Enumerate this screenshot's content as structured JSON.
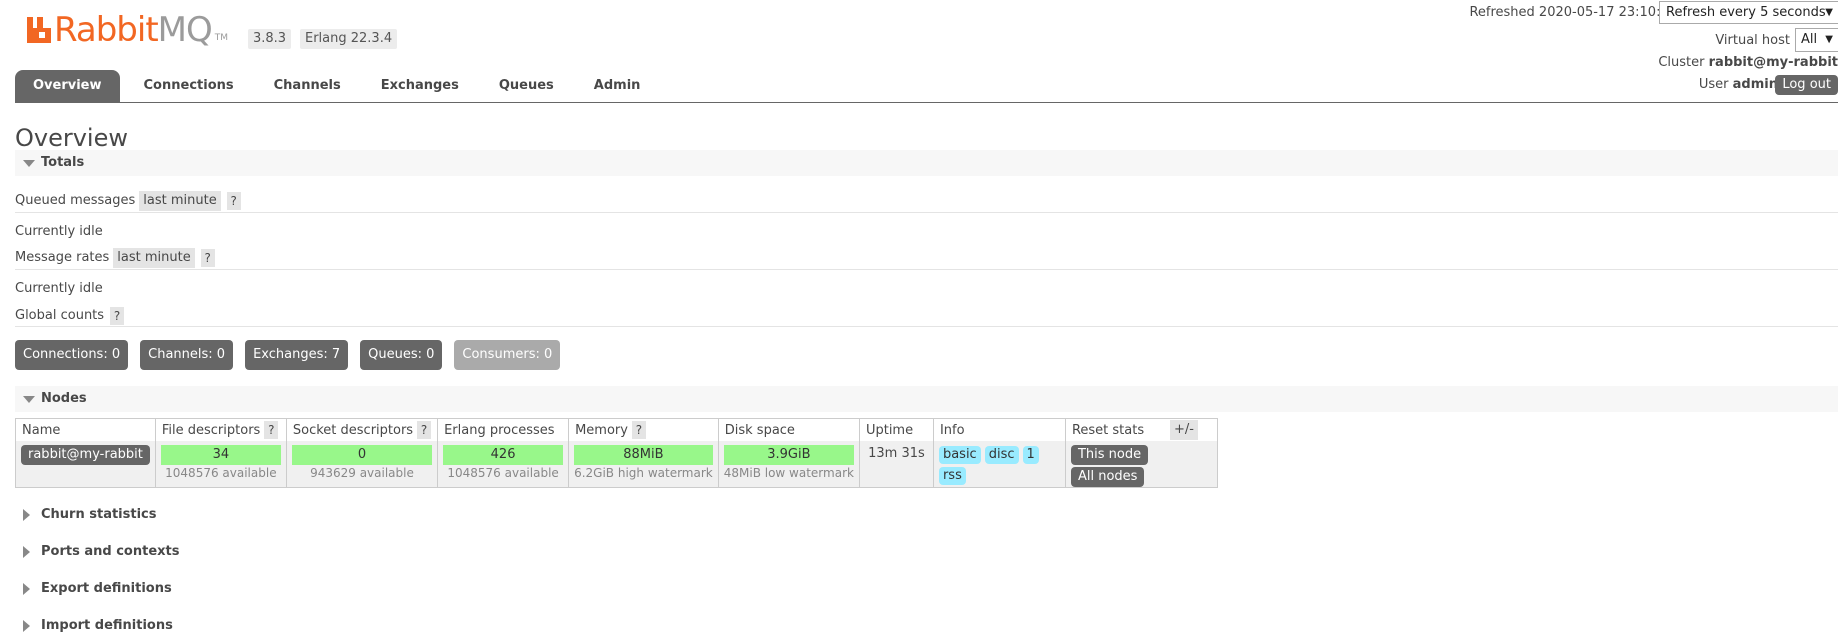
{
  "header": {
    "logo_rabbit": "Rabbit",
    "logo_mq": "MQ",
    "logo_tm": "TM",
    "version": "3.8.3",
    "erlang": "Erlang 22.3.4",
    "refreshed_label": "Refreshed",
    "refreshed_time": "2020-05-17 23:10:00",
    "refresh_select": "Refresh every 5 seconds",
    "vhost_label": "Virtual host",
    "vhost_value": "All",
    "cluster_label": "Cluster",
    "cluster_value": "rabbit@my-rabbit",
    "user_label": "User",
    "user_value": "admin",
    "logout": "Log out"
  },
  "nav": {
    "tabs": [
      {
        "label": "Overview",
        "active": true
      },
      {
        "label": "Connections"
      },
      {
        "label": "Channels"
      },
      {
        "label": "Exchanges"
      },
      {
        "label": "Queues"
      },
      {
        "label": "Admin"
      }
    ]
  },
  "main": {
    "title": "Overview",
    "totals": {
      "label": "Totals",
      "queued_label": "Queued messages",
      "queued_range": "last minute",
      "help": "?",
      "idle1": "Currently idle",
      "rates_label": "Message rates",
      "rates_range": "last minute",
      "idle2": "Currently idle",
      "global_label": "Global counts",
      "counts": {
        "connections": "Connections: 0",
        "channels": "Channels: 0",
        "exchanges": "Exchanges: 7",
        "queues": "Queues: 0",
        "consumers": "Consumers: 0"
      }
    },
    "nodes": {
      "label": "Nodes",
      "columns": {
        "name": "Name",
        "fd": "File descriptors",
        "sd": "Socket descriptors",
        "erl": "Erlang processes",
        "mem": "Memory",
        "disk": "Disk space",
        "uptime": "Uptime",
        "info": "Info",
        "reset": "Reset stats"
      },
      "row": {
        "name": "rabbit@my-rabbit",
        "fd": "34",
        "fd_sub": "1048576 available",
        "sd": "0",
        "sd_sub": "943629 available",
        "erl": "426",
        "erl_sub": "1048576 available",
        "mem": "88MiB",
        "mem_sub": "6.2GiB high watermark",
        "disk": "3.9GiB",
        "disk_sub": "48MiB low watermark",
        "uptime": "13m 31s",
        "info": [
          "basic",
          "disc",
          "1",
          "rss"
        ],
        "reset_this": "This node",
        "reset_all": "All nodes"
      },
      "plusminus": "+/-"
    },
    "collapsed_sections": {
      "churn": "Churn statistics",
      "ports": "Ports and contexts",
      "export": "Export definitions",
      "import": "Import definitions"
    }
  },
  "colors": {
    "brand_orange": "#f26723",
    "bar_green": "#98f78a",
    "info_blue": "#99ebff",
    "button_gray": "#666666"
  }
}
